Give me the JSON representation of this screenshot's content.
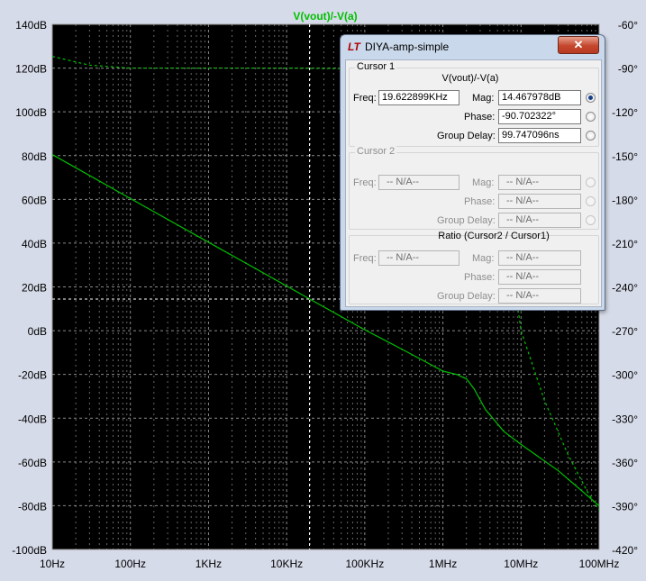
{
  "chart_data": {
    "type": "line",
    "title": "V(vout)/-V(a)",
    "x_scale": "log",
    "x_ticks": [
      "10Hz",
      "100Hz",
      "1KHz",
      "10KHz",
      "100KHz",
      "1MHz",
      "10MHz",
      "100MHz"
    ],
    "x_tick_values": [
      10,
      100,
      1000,
      10000,
      100000,
      1000000,
      10000000,
      100000000
    ],
    "xlim": [
      10,
      100000000
    ],
    "y_left_ticks": [
      "140dB",
      "120dB",
      "100dB",
      "80dB",
      "60dB",
      "40dB",
      "20dB",
      "0dB",
      "-20dB",
      "-40dB",
      "-60dB",
      "-80dB",
      "-100dB"
    ],
    "y_left_values": [
      140,
      120,
      100,
      80,
      60,
      40,
      20,
      0,
      -20,
      -40,
      -60,
      -80,
      -100
    ],
    "ylim_left": [
      -100,
      140
    ],
    "y_right_ticks": [
      "-60°",
      "-90°",
      "-120°",
      "-150°",
      "-180°",
      "-210°",
      "-240°",
      "-270°",
      "-300°",
      "-330°",
      "-360°",
      "-390°",
      "-420°"
    ],
    "y_right_values": [
      -60,
      -90,
      -120,
      -150,
      -180,
      -210,
      -240,
      -270,
      -300,
      -330,
      -360,
      -390,
      -420
    ],
    "ylim_right": [
      -420,
      -60
    ],
    "grid": true,
    "series": [
      {
        "name": "magnitude",
        "axis": "left",
        "style": "solid",
        "x": [
          10,
          100,
          1000,
          10000,
          19623,
          100000,
          300000,
          700000,
          1000000,
          1500000,
          2000000,
          2500000,
          3500000,
          6000000,
          10000000,
          30000000,
          100000000
        ],
        "y": [
          80.5,
          60.4,
          40.4,
          20.4,
          14.5,
          0.4,
          -8.5,
          -15.5,
          -18.5,
          -20.0,
          -22.0,
          -26.5,
          -36.0,
          -46.0,
          -52.0,
          -64.0,
          -80.0
        ]
      },
      {
        "name": "phase",
        "axis": "right",
        "style": "dashed",
        "x": [
          10,
          30,
          100,
          1000,
          10000,
          100000,
          300000,
          1000000,
          2000000,
          4000000,
          7000000,
          10000000,
          20000000,
          40000000,
          70000000,
          100000000
        ],
        "y": [
          -82,
          -88,
          -90,
          -90,
          -90,
          -90.5,
          -92,
          -96,
          -110,
          -150,
          -210,
          -270,
          -318,
          -355,
          -380,
          -393
        ]
      }
    ],
    "cursor": {
      "freq": 19622.899,
      "mag": 14.467978
    }
  },
  "dialog": {
    "title": "DIYA-amp-simple",
    "close_label": "✕",
    "cursor1": {
      "title": "Cursor 1",
      "trace": "V(vout)/-V(a)",
      "freq_label": "Freq:",
      "freq_value": "19.622899KHz",
      "mag_label": "Mag:",
      "mag_value": "14.467978dB",
      "phase_label": "Phase:",
      "phase_value": "-90.702322°",
      "gd_label": "Group Delay:",
      "gd_value": "99.747096ns"
    },
    "cursor2": {
      "title": "Cursor 2",
      "freq_label": "Freq:",
      "freq_value": "-- N/A--",
      "mag_label": "Mag:",
      "mag_value": "-- N/A--",
      "phase_label": "Phase:",
      "phase_value": "-- N/A--",
      "gd_label": "Group Delay:",
      "gd_value": "-- N/A--"
    },
    "ratio": {
      "title": "Ratio (Cursor2 / Cursor1)",
      "freq_label": "Freq:",
      "freq_value": "-- N/A--",
      "mag_label": "Mag:",
      "mag_value": "-- N/A--",
      "phase_label": "Phase:",
      "phase_value": "-- N/A--",
      "gd_label": "Group Delay:",
      "gd_value": "-- N/A--"
    }
  },
  "colors": {
    "plot_bg": "#000000",
    "grid": "#8a8a8a",
    "trace": "#00c000",
    "cursor": "#ffffff"
  }
}
